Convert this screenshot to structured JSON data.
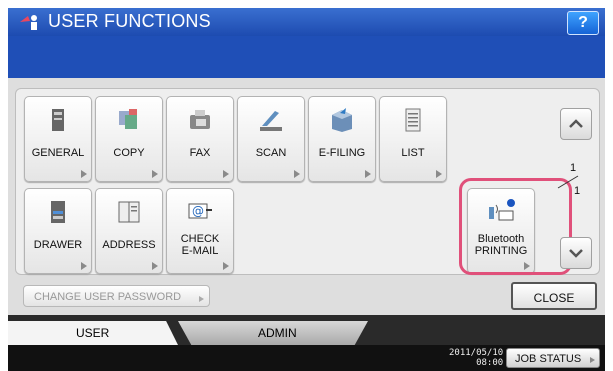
{
  "header": {
    "title": "USER FUNCTIONS",
    "help_label": "?"
  },
  "tiles": {
    "general": "GENERAL",
    "copy": "COPY",
    "fax": "FAX",
    "scan": "SCAN",
    "efiling": "E-FILING",
    "list": "LIST",
    "drawer": "DRAWER",
    "address": "ADDRESS",
    "check_email_1": "CHECK",
    "check_email_2": "E-MAIL",
    "bt_1": "Bluetooth",
    "bt_2": "PRINTING"
  },
  "pager": {
    "current": "1",
    "total": "1"
  },
  "buttons": {
    "change_password": "CHANGE USER PASSWORD",
    "close": "CLOSE",
    "job_status": "JOB STATUS"
  },
  "tabs": {
    "user": "USER",
    "admin": "ADMIN"
  },
  "status": {
    "date": "2011/05/10",
    "time": "08:00"
  },
  "colors": {
    "title_bar": "#1d4bb0",
    "highlight": "#e0507a"
  }
}
